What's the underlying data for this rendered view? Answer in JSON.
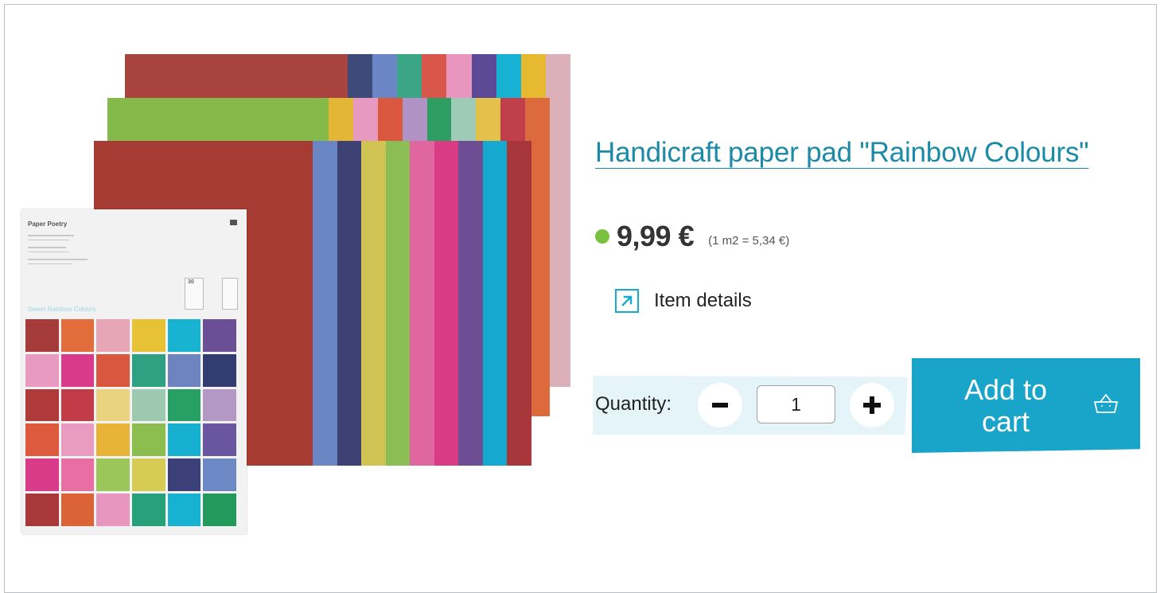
{
  "product": {
    "title": "Handicraft paper pad \"Rainbow Colours\"",
    "price": "9,99 €",
    "unit_price": "(1 m2 = 5,34 €)",
    "availability_color": "#7ac142"
  },
  "details": {
    "label": "Item details",
    "icon": "external-arrow-icon"
  },
  "quantity": {
    "label": "Quantity:",
    "value": "1",
    "minus_icon": "minus-icon",
    "plus_icon": "plus-icon"
  },
  "cart": {
    "label": "Add to cart",
    "icon": "basket-icon",
    "color": "#19a4c9"
  },
  "image": {
    "pad_brand": "Paper Poetry",
    "pad_title": "Sweet Rainbow Colours",
    "pad_count": "30",
    "back_sheet_colors": [
      "#a8433d",
      "#3d4a7a",
      "#6b86c4",
      "#3aa685",
      "#d9574a",
      "#e896bd",
      "#5d4a96",
      "#17b2d3",
      "#e5b930",
      "#dcb0b8"
    ],
    "middle_sheet_colors": [
      "#85b94a",
      "#e4b636",
      "#e899bf",
      "#d9583f",
      "#b093c4",
      "#2e9d61",
      "#9dcbb5",
      "#e3c14b",
      "#c03f4a",
      "#dc6a3c"
    ],
    "front_sheet_colors": [
      "#a63b34",
      "#6a86c4",
      "#3d4173",
      "#cfc453",
      "#8bbd55",
      "#e0669f",
      "#d93b85",
      "#6d4e95",
      "#15a9cf",
      "#a7373a"
    ],
    "swatch_colors": [
      "#a63b3c",
      "#e16d3a",
      "#e7a6b6",
      "#e8c235",
      "#19b3d2",
      "#6b4f96",
      "#e99ac0",
      "#d93b8a",
      "#d9573f",
      "#2fa081",
      "#6e84c0",
      "#333c70",
      "#b03a3a",
      "#c23c48",
      "#ead37e",
      "#9cc9b0",
      "#26a064",
      "#b397c5",
      "#dd5a3f",
      "#ea9bc0",
      "#e8b437",
      "#8bbd4f",
      "#17b0d0",
      "#6a55a0",
      "#d93b88",
      "#e96ea4",
      "#9bc75a",
      "#d6cc55",
      "#3b4178",
      "#6c88c5",
      "#a8383a",
      "#dc6336",
      "#e896bd",
      "#28a07a",
      "#17b1d2",
      "#239a5b"
    ]
  }
}
